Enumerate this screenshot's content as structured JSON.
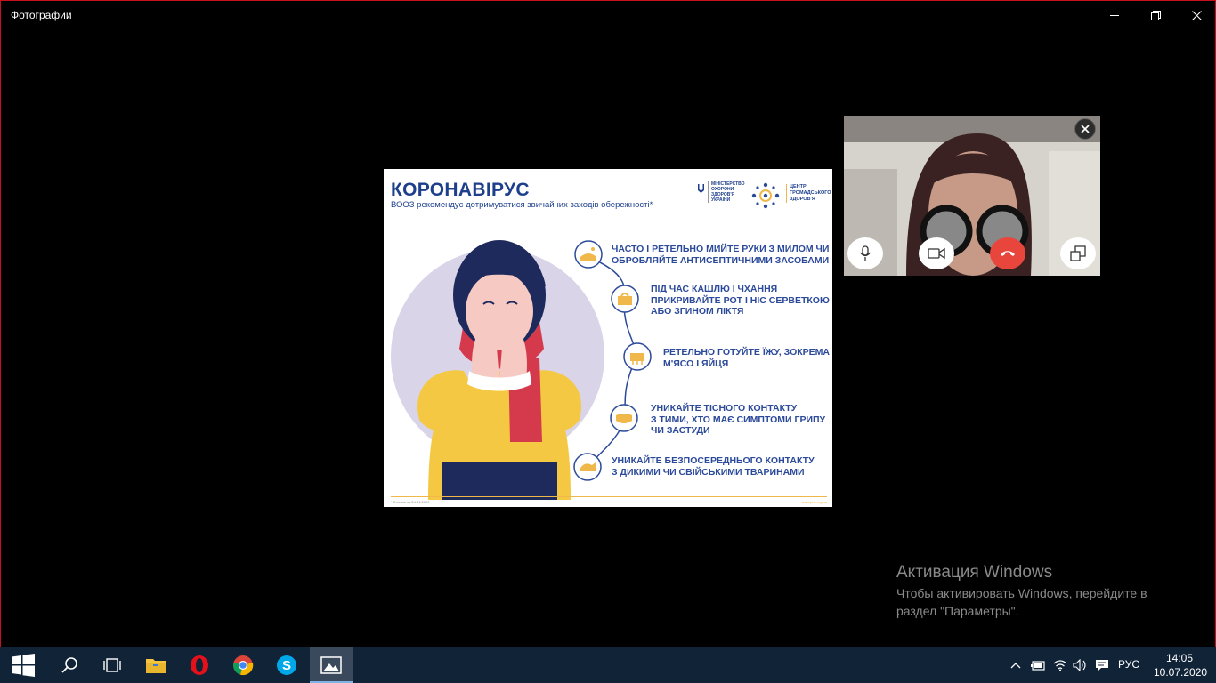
{
  "app": {
    "title": "Фотографии"
  },
  "poster": {
    "title": "КОРОНАВІРУС",
    "subtitle": "ВООЗ рекомендує дотримуватися звичайних заходів обережності*",
    "logo_ministry": [
      "МІНІСТЕРСТВО",
      "ОХОРОНИ",
      "ЗДОРОВ'Я",
      "УКРАЇНИ"
    ],
    "logo_center": [
      "ЦЕНТР",
      "ГРОМАДСЬКОГО",
      "ЗДОРОВ'Я"
    ],
    "tips": [
      [
        "ЧАСТО І РЕТЕЛЬНО МИЙТЕ РУКИ З МИЛОМ ЧИ",
        "ОБРОБЛЯЙТЕ АНТИСЕПТИЧНИМИ ЗАСОБАМИ"
      ],
      [
        "ПІД ЧАС КАШЛЮ І ЧХАННЯ",
        "ПРИКРИВАЙТЕ РОТ І НІС СЕРВЕТКОЮ",
        "АБО ЗГИНОМ ЛІКТЯ"
      ],
      [
        "РЕТЕЛЬНО ГОТУЙТЕ ЇЖУ, ЗОКРЕМА",
        "М'ЯСО І ЯЙЦЯ"
      ],
      [
        "УНИКАЙТЕ ТІСНОГО КОНТАКТУ",
        "З ТИМИ, ХТО МАЄ СИМПТОМИ ГРИПУ",
        "ЧИ ЗАСТУДИ"
      ],
      [
        "УНИКАЙТЕ БЕЗПОСЕРЕДНЬОГО КОНТАКТУ",
        "З ДИКИМИ ЧИ СВІЙСЬКИМИ ТВАРИНАМИ"
      ]
    ],
    "footnote": "* Станом на 24.01.2020",
    "website": "www.phc.org.ua"
  },
  "video_call": {
    "controls": [
      "microphone-icon",
      "camera-icon",
      "hang-up-icon",
      "switch-view-icon"
    ],
    "hangup_color": "#e8453c"
  },
  "activation": {
    "title": "Активация Windows",
    "line1": "Чтобы активировать Windows, перейдите в",
    "line2": "раздел \"Параметры\"."
  },
  "taskbar": {
    "apps": [
      "start-icon",
      "search-icon",
      "task-view-icon",
      "file-explorer-icon",
      "opera-icon",
      "chrome-icon",
      "skype-icon",
      "photos-icon"
    ],
    "active_app": "photos-icon",
    "language": "РУС",
    "time": "14:05",
    "date": "10.07.2020"
  },
  "colors": {
    "window_border": "#c8101e",
    "taskbar_bg": "#102337",
    "poster_title": "#1d3f8c",
    "accent_orange": "#f0b74a"
  }
}
